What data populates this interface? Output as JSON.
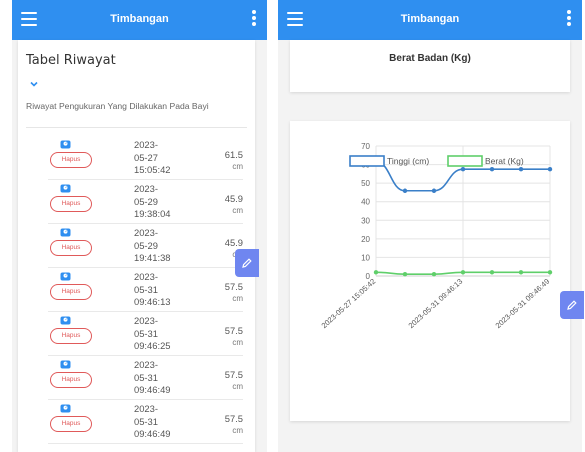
{
  "left": {
    "appbar": {
      "title": "Timbangan",
      "menu_icon": "hamburger-menu-icon",
      "more_icon": "more-vert-icon"
    },
    "history": {
      "title": "Tabel Riwayat",
      "subtitle": "Riwayat Pengukuran Yang Dilakukan Pada Bayi",
      "delete_label": "Hapus",
      "rows": [
        {
          "date": "2023-05-27 15:05:42",
          "d1": "2023-",
          "d2": "05-27",
          "d3": "15:05:42",
          "value": "61.5",
          "unit": "cm"
        },
        {
          "date": "2023-05-29 19:38:04",
          "d1": "2023-",
          "d2": "05-29",
          "d3": "19:38:04",
          "value": "45.9",
          "unit": "cm"
        },
        {
          "date": "2023-05-29 19:41:38",
          "d1": "2023-",
          "d2": "05-29",
          "d3": "19:41:38",
          "value": "45.9",
          "unit": "cm"
        },
        {
          "date": "2023-05-31 09:46:13",
          "d1": "2023-",
          "d2": "05-31",
          "d3": "09:46:13",
          "value": "57.5",
          "unit": "cm"
        },
        {
          "date": "2023-05-31 09:46:25",
          "d1": "2023-",
          "d2": "05-31",
          "d3": "09:46:25",
          "value": "57.5",
          "unit": "cm"
        },
        {
          "date": "2023-05-31 09:46:49",
          "d1": "2023-",
          "d2": "05-31",
          "d3": "09:46:49",
          "value": "57.5",
          "unit": "cm"
        },
        {
          "date": "2023-05-31 09:46:49",
          "d1": "2023-",
          "d2": "05-31",
          "d3": "09:46:49",
          "value": "57.5",
          "unit": "cm"
        }
      ]
    },
    "fab_icon": "pencil-icon"
  },
  "right": {
    "appbar": {
      "title": "Timbangan"
    },
    "berat_card_title": "Berat Badan (Kg)",
    "fab_icon": "pencil-icon"
  },
  "colors": {
    "primary": "#2f8ff0",
    "delete": "#e05a5a",
    "fab": "#6f86f0",
    "tinggi": "#3a7fc8",
    "berat": "#5fcf6a"
  },
  "chart_data": {
    "type": "line",
    "x": [
      "2023-05-27 15:05:42",
      "2023-05-29 19:38:04",
      "2023-05-29 19:41:38",
      "2023-05-31 09:46:13",
      "2023-05-31 09:46:25",
      "2023-05-31 09:46:49",
      "2023-05-31 09:46:49"
    ],
    "x_tick_labels": [
      "2023-05-27 15:05:42",
      "2023-05-31 09:46:13",
      "2023-05-31 09:46:49"
    ],
    "series": [
      {
        "name": "Tinggi (cm)",
        "values": [
          61.5,
          45.9,
          45.9,
          57.5,
          57.5,
          57.5,
          57.5
        ],
        "color": "#3a7fc8"
      },
      {
        "name": "Berat (Kg)",
        "values": [
          2,
          1,
          1,
          2,
          2,
          2,
          2
        ],
        "color": "#5fcf6a"
      }
    ],
    "yticks": [
      0,
      10,
      20,
      30,
      40,
      50,
      60,
      70
    ],
    "ylim": [
      0,
      70
    ],
    "grid": true,
    "legend": "top"
  }
}
